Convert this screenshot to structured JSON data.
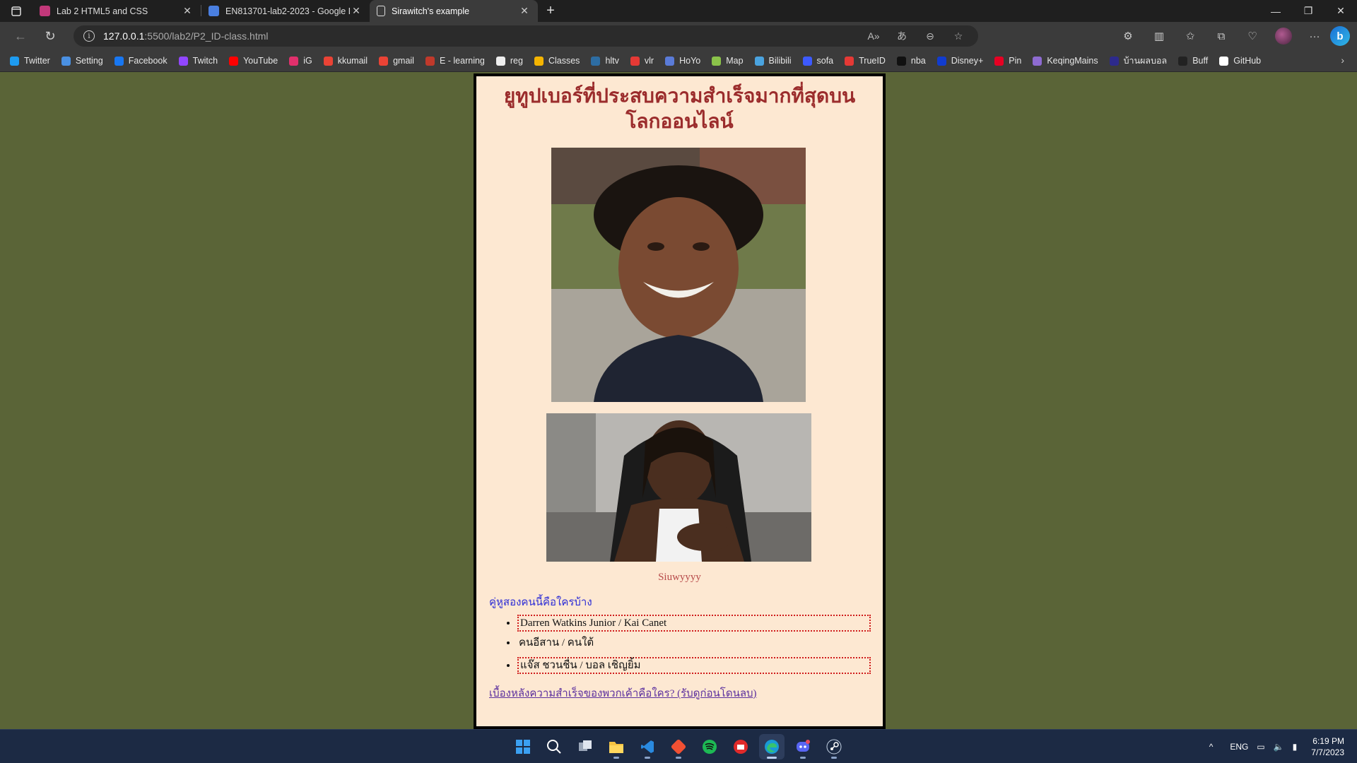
{
  "browser": {
    "tabs": [
      {
        "title": "Lab 2 HTML5 and CSS",
        "favicon_color": "#c2387a",
        "active": false
      },
      {
        "title": "EN813701-lab2-2023 - Google D",
        "favicon_color": "#4a7fe0",
        "active": false
      },
      {
        "title": "Sirawitch's example",
        "favicon_color": "#dddddd",
        "active": true
      }
    ],
    "new_tab_symbol": "+",
    "address": {
      "host": "127.0.0.1",
      "path": ":5500/lab2/P2_ID-class.html"
    },
    "bookmarks": [
      {
        "label": "Twitter",
        "icon": "twitter-icon",
        "color": "#1d9bf0"
      },
      {
        "label": "Setting",
        "icon": "gear-icon",
        "color": "#4a90e2"
      },
      {
        "label": "Facebook",
        "icon": "facebook-icon",
        "color": "#1877f2"
      },
      {
        "label": "Twitch",
        "icon": "twitch-icon",
        "color": "#9146ff"
      },
      {
        "label": "YouTube",
        "icon": "youtube-icon",
        "color": "#ff0000"
      },
      {
        "label": "iG",
        "icon": "instagram-icon",
        "color": "#e1306c"
      },
      {
        "label": "kkumail",
        "icon": "gmail-icon",
        "color": "#ea4335"
      },
      {
        "label": "gmail",
        "icon": "gmail-icon",
        "color": "#ea4335"
      },
      {
        "label": "E - learning",
        "icon": "elearning-icon",
        "color": "#c0392b"
      },
      {
        "label": "reg",
        "icon": "reg-icon",
        "color": "#eeeeee"
      },
      {
        "label": "Classes",
        "icon": "classroom-icon",
        "color": "#f4b400"
      },
      {
        "label": "hltv",
        "icon": "hltv-icon",
        "color": "#2d6da3"
      },
      {
        "label": "vlr",
        "icon": "vlr-icon",
        "color": "#e53935"
      },
      {
        "label": "HoYo",
        "icon": "hoyo-icon",
        "color": "#5a7bd8"
      },
      {
        "label": "Map",
        "icon": "map-icon",
        "color": "#8bc34a"
      },
      {
        "label": "Bilibili",
        "icon": "bilibili-icon",
        "color": "#4aa3df"
      },
      {
        "label": "sofa",
        "icon": "sofa-icon",
        "color": "#3d5afe"
      },
      {
        "label": "TrueID",
        "icon": "trueid-icon",
        "color": "#e53935"
      },
      {
        "label": "nba",
        "icon": "nba-icon",
        "color": "#111111"
      },
      {
        "label": "Disney+",
        "icon": "disney-icon",
        "color": "#113ccf"
      },
      {
        "label": "Pin",
        "icon": "pinterest-icon",
        "color": "#e60023"
      },
      {
        "label": "KeqingMains",
        "icon": "keqing-icon",
        "color": "#8e6bd1"
      },
      {
        "label": "บ้านผลบอล",
        "icon": "thai-flag-icon",
        "color": "#2d2a8c"
      },
      {
        "label": "Buff",
        "icon": "buff-icon",
        "color": "#222222"
      },
      {
        "label": "GitHub",
        "icon": "github-icon",
        "color": "#ffffff"
      }
    ]
  },
  "page": {
    "heading": "ยูทูปเบอร์ที่ประสบความสำเร็จมากที่สุดบนโลกออนไลน์",
    "photo1_alt": "smiling young man selfie outdoors",
    "photo2_alt": "man with dreadlocks and tattoos in gaming chair",
    "caption": "Siuwyyyy",
    "subheading": "คู่หูสองคนนี้คือใครบ้าง",
    "list": [
      {
        "text": "Darren Watkins Junior / Kai Canet",
        "boxed": true
      },
      {
        "text": "คนอีสาน / คนใต้",
        "boxed": false
      },
      {
        "text": "แจ๊ส ชวนชื่น / บอล เชิญยิ้ม",
        "boxed": true
      }
    ],
    "link": "เบื้องหลังความสำเร็จของพวกเค้าคือใคร? (รับดูก่อนโดนลบ)",
    "colors": {
      "background": "#5a6437",
      "card": "#fde8d2",
      "heading": "#9b2c2c",
      "subhead": "#2c2cd6",
      "link": "#5b2f9e",
      "border": "#d01c1c"
    }
  },
  "taskbar": {
    "apps": [
      "windows-start-icon",
      "search-icon",
      "task-view-icon",
      "file-explorer-icon",
      "vscode-icon",
      "git-icon",
      "spotify-icon",
      "app-icon",
      "edge-icon",
      "discord-icon",
      "steam-icon"
    ],
    "language": "ENG",
    "time": "6:19 PM",
    "date": "7/7/2023"
  }
}
